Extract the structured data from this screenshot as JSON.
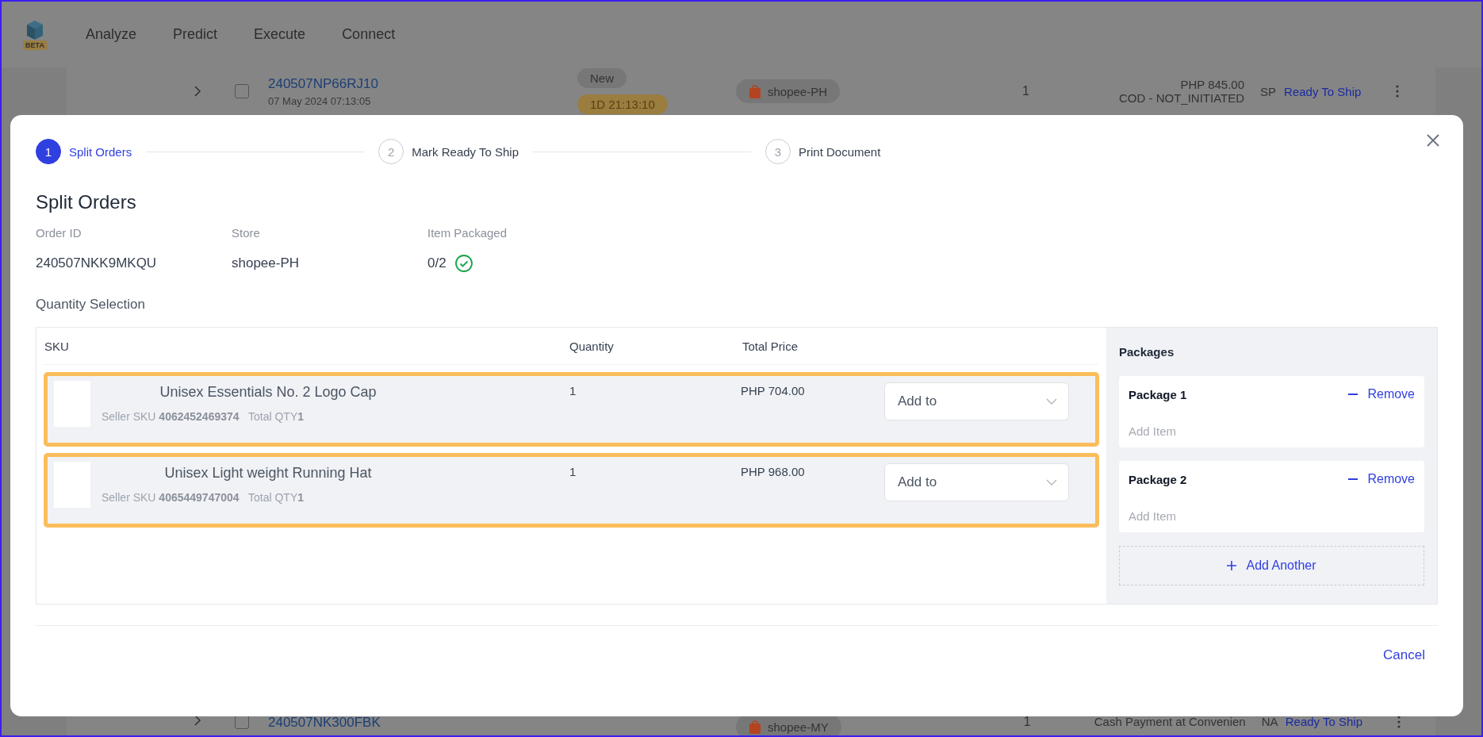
{
  "nav": {
    "badge": "BETA",
    "items": [
      "Analyze",
      "Predict",
      "Execute",
      "Connect"
    ]
  },
  "background_rows": [
    {
      "checked": false,
      "order_id": "240507NP66RJ10",
      "date": "07 May 2024 07:13:05",
      "status": "New",
      "timer": "1D 21:13:10",
      "store": "shopee-PH",
      "quantity": "1",
      "price": "PHP 845.00",
      "payment": "COD - NOT_INITIATED",
      "column_8": "SP",
      "action": "Ready To Ship"
    },
    {
      "checked": false,
      "order_id": "240507NK300FBK",
      "store": "shopee-MY",
      "quantity": "1",
      "payment": "Cash Payment at Convenien",
      "column_8": "NA",
      "action": "Ready To Ship"
    }
  ],
  "dialog": {
    "steps": [
      {
        "number": "1",
        "label": "Split Orders",
        "selected": true
      },
      {
        "number": "2",
        "label": "Mark Ready To Ship",
        "selected": false
      },
      {
        "number": "3",
        "label": "Print Document",
        "selected": false
      }
    ],
    "title": "Split Orders",
    "fields": [
      {
        "label": "Order ID",
        "value": "240507NKK9MKQU",
        "kind": "text"
      },
      {
        "label": "Store",
        "value": "shopee-PH",
        "kind": "text"
      },
      {
        "label": "Item Packaged",
        "value": "0/2",
        "kind": "progress"
      }
    ],
    "section_title": "Quantity Selection",
    "table": {
      "columns": [
        "SKU",
        "Quantity",
        "Total Price"
      ],
      "rows": [
        {
          "name": "Unisex Essentials No. 2 Logo Cap",
          "details": "Seller SKU **4062452469374**   Total QTY**1**",
          "quantity": "1",
          "price": "PHP 704.00",
          "dropdown": "Add to",
          "highlighted": true
        },
        {
          "name": "Unisex Light weight Running Hat",
          "details": "Seller SKU **4065449747004**   Total QTY**1**",
          "quantity": "1",
          "price": "PHP 968.00",
          "dropdown": "Add to",
          "highlighted": true
        }
      ]
    },
    "packages": {
      "title": "Packages",
      "items": [
        {
          "name": "Package 1",
          "action": "Remove",
          "placeholder": "Add Item"
        },
        {
          "name": "Package 2",
          "action": "Remove",
          "placeholder": "Add Item"
        }
      ],
      "add_button": "Add Another"
    },
    "cancel_button": "Cancel"
  }
}
